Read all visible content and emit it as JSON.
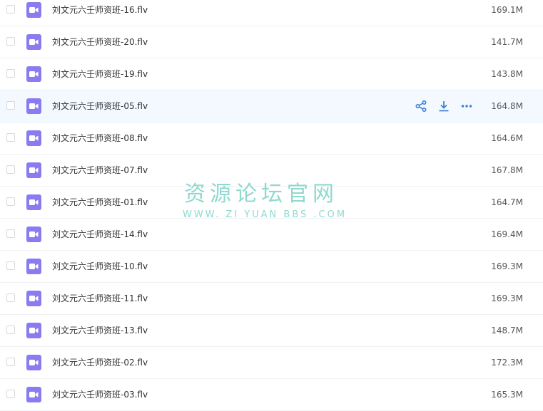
{
  "files": [
    {
      "name": "刘文元六壬师资班-16.flv",
      "size": "169.1M"
    },
    {
      "name": "刘文元六壬师资班-20.flv",
      "size": "141.7M"
    },
    {
      "name": "刘文元六壬师资班-19.flv",
      "size": "143.8M"
    },
    {
      "name": "刘文元六壬师资班-05.flv",
      "size": "164.8M",
      "hovered": true
    },
    {
      "name": "刘文元六壬师资班-08.flv",
      "size": "164.6M"
    },
    {
      "name": "刘文元六壬师资班-07.flv",
      "size": "167.8M"
    },
    {
      "name": "刘文元六壬师资班-01.flv",
      "size": "164.7M"
    },
    {
      "name": "刘文元六壬师资班-14.flv",
      "size": "169.4M"
    },
    {
      "name": "刘文元六壬师资班-10.flv",
      "size": "169.3M"
    },
    {
      "name": "刘文元六壬师资班-11.flv",
      "size": "169.3M"
    },
    {
      "name": "刘文元六壬师资班-13.flv",
      "size": "148.7M"
    },
    {
      "name": "刘文元六壬师资班-02.flv",
      "size": "172.3M"
    },
    {
      "name": "刘文元六壬师资班-03.flv",
      "size": "165.3M"
    }
  ],
  "row_actions": [
    {
      "icon": "share-icon"
    },
    {
      "icon": "download-icon"
    },
    {
      "icon": "more-icon"
    }
  ],
  "watermark": {
    "title": "资源论坛官网",
    "subtitle": "WWW. ZI YUAN BBS .COM"
  },
  "colors": {
    "file_icon": "#8a7cf0",
    "action_icon": "#3b7fd9",
    "watermark": "#8fd9cf",
    "hover_row": "#f4f9ff"
  }
}
